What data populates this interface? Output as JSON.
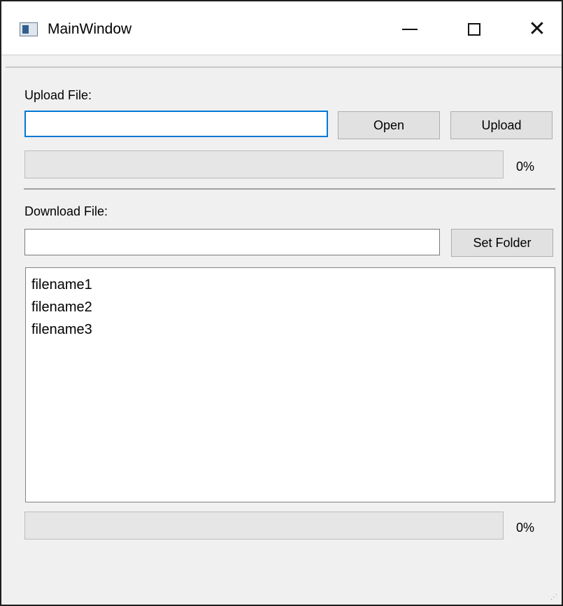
{
  "window": {
    "title": "MainWindow",
    "controls": {
      "minimize": "—",
      "maximize": "☐",
      "close": "✕"
    }
  },
  "upload": {
    "label": "Upload File:",
    "path_value": "",
    "open_label": "Open",
    "upload_label": "Upload",
    "progress_value": 0,
    "progress_text": "0%"
  },
  "download": {
    "label": "Download File:",
    "folder_value": "",
    "set_folder_label": "Set Folder",
    "files": [
      "filename1",
      "filename2",
      "filename3"
    ],
    "progress_value": 0,
    "progress_text": "0%"
  },
  "colors": {
    "focus_border": "#0078d7",
    "progress_fill": "#06b025",
    "window_bg": "#f0f0f0"
  }
}
